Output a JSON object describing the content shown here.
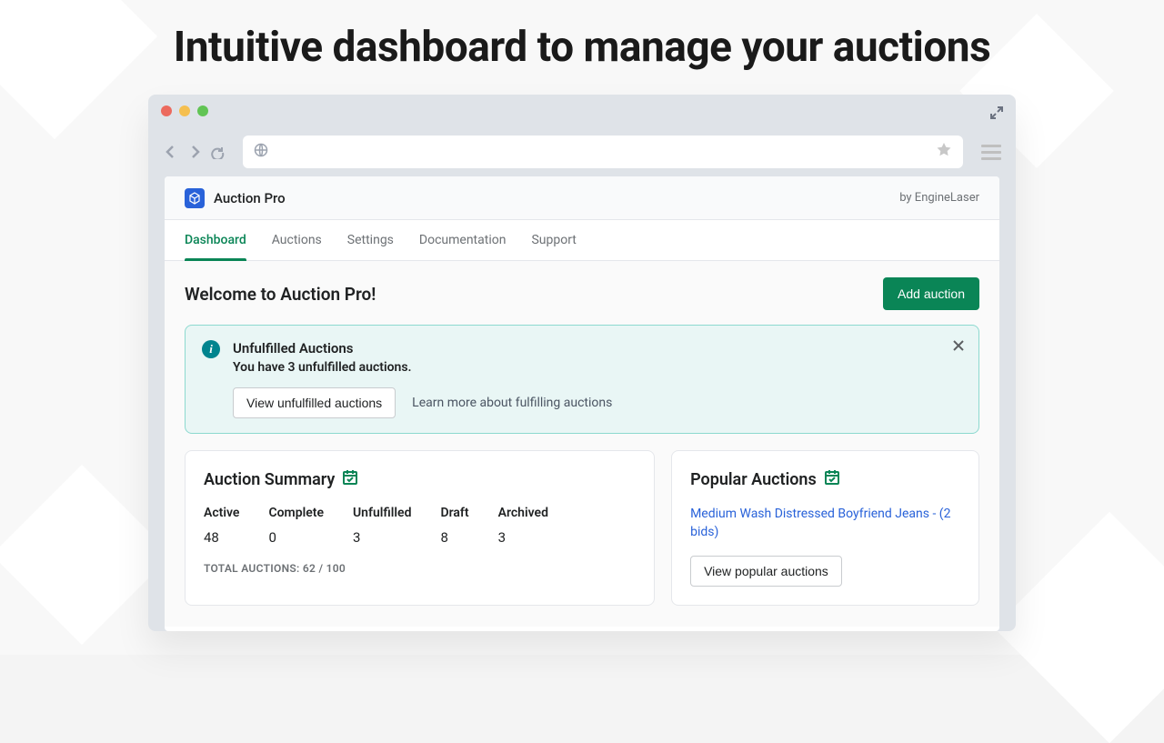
{
  "hero": {
    "title": "Intuitive dashboard to manage your auctions"
  },
  "app": {
    "name": "Auction Pro",
    "vendor": "by EngineLaser"
  },
  "tabs": [
    {
      "label": "Dashboard",
      "active": true
    },
    {
      "label": "Auctions",
      "active": false
    },
    {
      "label": "Settings",
      "active": false
    },
    {
      "label": "Documentation",
      "active": false
    },
    {
      "label": "Support",
      "active": false
    }
  ],
  "page": {
    "title": "Welcome to Auction Pro!",
    "add_button": "Add auction"
  },
  "banner": {
    "title": "Unfulfilled Auctions",
    "message": "You have 3 unfulfilled auctions.",
    "action_button": "View unfulfilled auctions",
    "action_link": "Learn more about fulfilling auctions"
  },
  "summary": {
    "title": "Auction Summary",
    "stats": [
      {
        "label": "Active",
        "value": "48"
      },
      {
        "label": "Complete",
        "value": "0"
      },
      {
        "label": "Unfulfilled",
        "value": "3"
      },
      {
        "label": "Draft",
        "value": "8"
      },
      {
        "label": "Archived",
        "value": "3"
      }
    ],
    "total": "TOTAL AUCTIONS: 62 / 100"
  },
  "popular": {
    "title": "Popular Auctions",
    "item": "Medium Wash Distressed Boyfriend Jeans - (2 bids)",
    "button": "View popular auctions"
  }
}
